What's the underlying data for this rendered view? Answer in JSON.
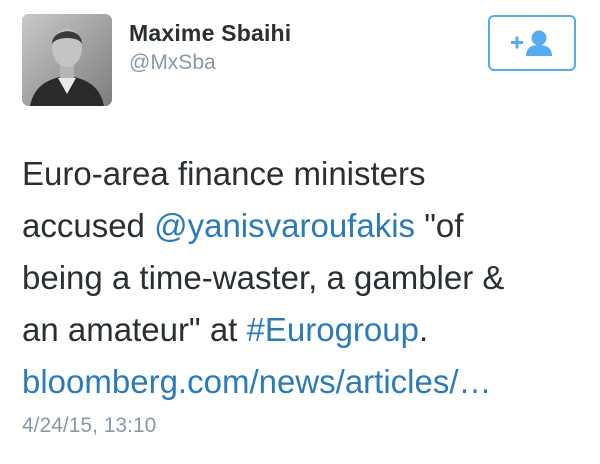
{
  "user": {
    "display_name": "Maxime Sbaihi",
    "handle": "@MxSba",
    "avatar_icon": "profile-photo"
  },
  "follow_button": {
    "icon": "follow-user-icon",
    "color": "#55acee"
  },
  "tweet": {
    "line1": "Euro-area finance ministers",
    "line2_pre": "accused ",
    "mention": "@yanisvaroufakis",
    "line2_post": " \"of",
    "line3": "being a time-waster, a gambler &",
    "line4_pre": "an amateur\" at ",
    "hashtag": "#Eurogroup",
    "line4_post": ".",
    "url": "bloomberg.com/news/articles/…"
  },
  "timestamp": "4/24/15, 13:10",
  "colors": {
    "text": "#292f33",
    "secondary": "#8899a6",
    "link": "#2b7bb9",
    "accent": "#55acee"
  }
}
